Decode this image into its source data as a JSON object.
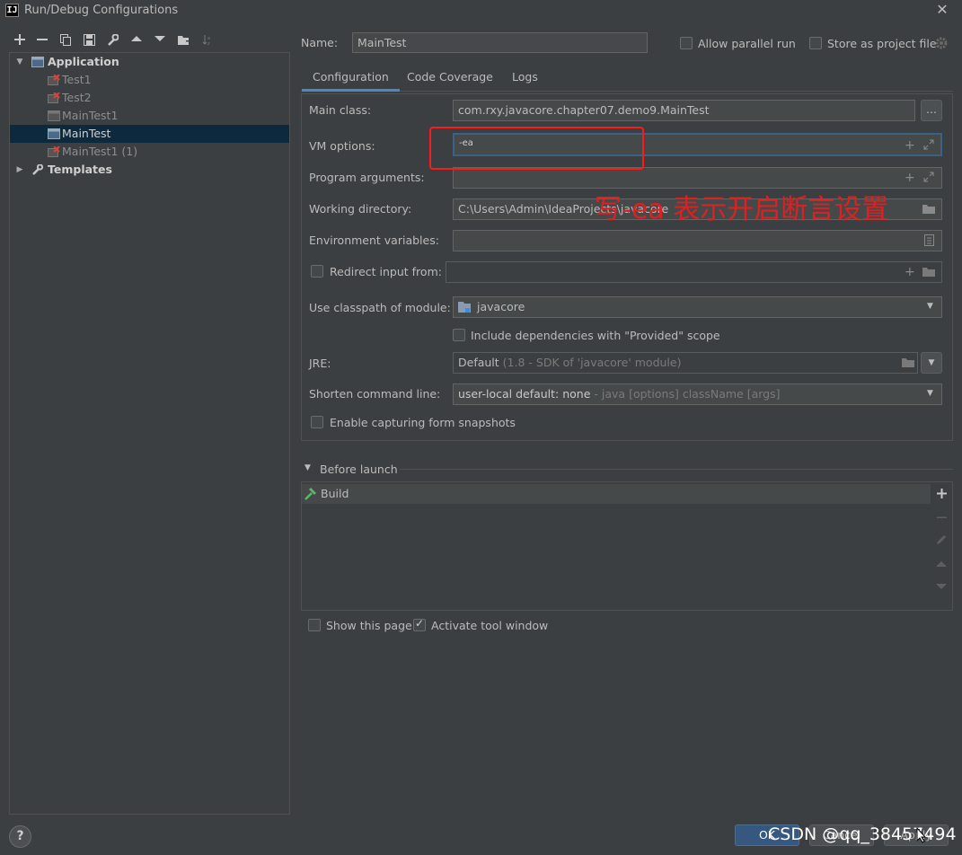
{
  "window": {
    "title": "Run/Debug Configurations",
    "logo_text": "IJ"
  },
  "toolbar": {
    "icons": [
      "add-icon",
      "remove-icon",
      "copy-icon",
      "save-icon",
      "wrench-icon",
      "move-up-icon",
      "move-down-icon",
      "new-folder-icon",
      "sort-icon"
    ]
  },
  "tree": {
    "application_label": "Application",
    "items": [
      {
        "label": "Test1",
        "error": true
      },
      {
        "label": "Test2",
        "error": true
      },
      {
        "label": "MainTest1",
        "error": false
      },
      {
        "label": "MainTest",
        "error": false,
        "selected": true
      },
      {
        "label": "MainTest1 (1)",
        "error": true
      }
    ],
    "templates_label": "Templates"
  },
  "header": {
    "name_label": "Name:",
    "name_value": "MainTest",
    "allow_parallel_label": "Allow parallel run",
    "store_project_label": "Store as project file"
  },
  "tabs": [
    {
      "label": "Configuration",
      "active": true
    },
    {
      "label": "Code Coverage",
      "active": false
    },
    {
      "label": "Logs",
      "active": false
    }
  ],
  "config": {
    "main_class_label": "Main class:",
    "main_class_value": "com.rxy.javacore.chapter07.demo9.MainTest",
    "browse_label": "...",
    "vm_options_label": "VM options:",
    "vm_options_value": "-ea",
    "program_args_label": "Program arguments:",
    "program_args_value": "",
    "working_dir_label": "Working directory:",
    "working_dir_value": "C:\\Users\\Admin\\IdeaProjects\\javacore",
    "env_vars_label": "Environment variables:",
    "env_vars_value": "",
    "redirect_label": "Redirect input from:",
    "redirect_value": "",
    "classpath_label": "Use classpath of module:",
    "classpath_value": "javacore",
    "include_deps_label": "Include dependencies with \"Provided\" scope",
    "jre_label": "JRE:",
    "jre_value": "Default",
    "jre_hint": "(1.8 - SDK of 'javacore' module)",
    "shorten_label": "Shorten command line:",
    "shorten_value": "user-local default: none",
    "shorten_hint": "- java [options] className [args]",
    "snapshots_label": "Enable capturing form snapshots"
  },
  "annotation": {
    "text": "写-ea  表示开启断言设置",
    "color": "#e02020"
  },
  "before_launch": {
    "title": "Before launch",
    "items": [
      {
        "label": "Build"
      }
    ]
  },
  "footer": {
    "show_page_label": "Show this page",
    "activate_tool_label": "Activate tool window",
    "help_label": "?",
    "ok_label": "OK",
    "cancel_label": "Cancel",
    "apply_label": "Apply",
    "watermark": "CSDN @qq_38457494"
  },
  "colors": {
    "background": "#3c3f41",
    "field": "#45494a",
    "selection": "#0d293e",
    "accent": "#4a88c7",
    "annotation": "#ff1a1a"
  }
}
